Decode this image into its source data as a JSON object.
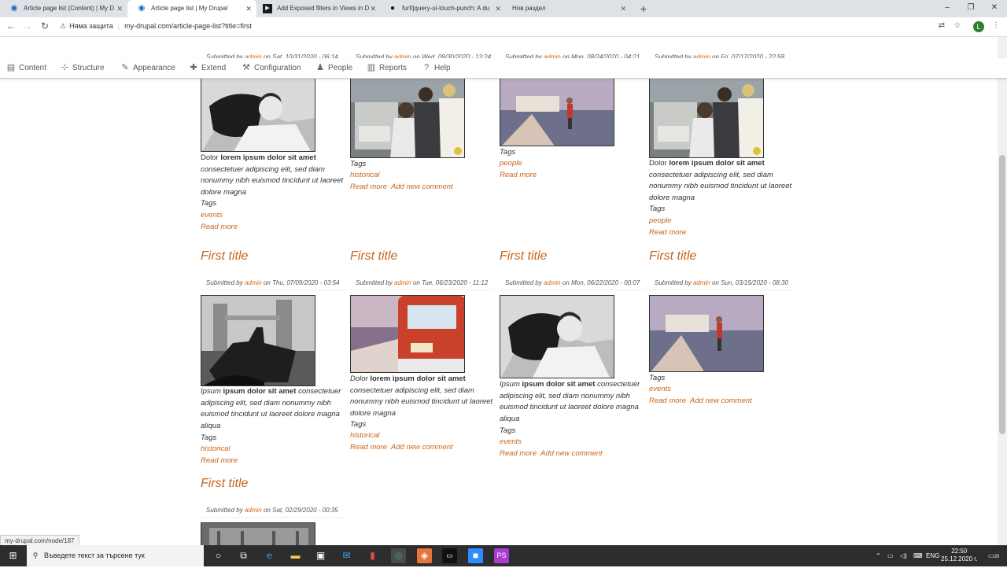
{
  "browser": {
    "tabs": [
      {
        "label": "Article page list (Content) | My D",
        "icon": "drupal-icon",
        "active": false
      },
      {
        "label": "Article page list | My Drupal",
        "icon": "drupal-icon",
        "active": true
      },
      {
        "label": "Add Exposed filters in Views in D",
        "icon": "video-icon",
        "active": false
      },
      {
        "label": "furf/jquery-ui-touch-punch: A du",
        "icon": "github-icon",
        "active": false
      },
      {
        "label": "Нов раздел",
        "icon": "",
        "active": false
      }
    ],
    "new_tab": "+",
    "window_controls": [
      "–",
      "❐",
      "✕"
    ],
    "security_label": "Няма защита",
    "url": "my-drupal.com/article-page-list?title=first",
    "profile_initial": "L"
  },
  "toolbar": {
    "items": [
      {
        "label": "Content",
        "icon": "content-icon"
      },
      {
        "label": "Structure",
        "icon": "structure-icon"
      },
      {
        "label": "Appearance",
        "icon": "appearance-icon"
      },
      {
        "label": "Extend",
        "icon": "extend-icon"
      },
      {
        "label": "Configuration",
        "icon": "configuration-icon"
      },
      {
        "label": "People",
        "icon": "people-icon"
      },
      {
        "label": "Reports",
        "icon": "reports-icon"
      },
      {
        "label": "Help",
        "icon": "help-icon"
      }
    ]
  },
  "content": {
    "submitted_by": "Submitted by",
    "on": "on",
    "author": "admin",
    "title": "First title",
    "tags_label": "Tags",
    "read_more": "Read more",
    "add_comment": "Add new comment",
    "top_row_dates": [
      "Sat, 10/31/2020 - 06:14",
      "Wed, 09/30/2020 - 13:24",
      "Mon, 08/24/2020 - 04:21",
      "Fri, 07/17/2020 - 22:58"
    ],
    "row1": {
      "c1": {
        "lead": "Dolor",
        "bold": "lorem ipsum dolor sit amet",
        "body": "consectetuer adipiscing elit, sed diam nonummy nibh euismod tincidunt ut laoreet dolore magna",
        "tag": "events"
      },
      "c2": {
        "tag": "historical"
      },
      "c3": {
        "tag": "people"
      },
      "c4": {
        "lead": "Dolor",
        "bold": "lorem ipsum dolor sit amet",
        "body": "consectetuer adipiscing elit, sed diam nonummy nibh euismod tincidunt ut laoreet dolore magna",
        "tag": "people"
      }
    },
    "row2": {
      "dates": [
        "Thu, 07/09/2020 - 03:54",
        "Tue, 06/23/2020 - 11:12",
        "Mon, 06/22/2020 - 00:07",
        "Sun, 03/15/2020 - 08:30"
      ],
      "c1": {
        "lead": "Ipsum",
        "bold": "ipsum dolor sit amet",
        "body": "consectetuer adipiscing elit, sed diam nonummy nibh euismod tincidunt ut laoreet dolore magna aliqua",
        "tag": "historical"
      },
      "c2": {
        "lead": "Dolor",
        "bold": "lorem ipsum dolor sit amet",
        "body": "consectetuer adipiscing elit, sed diam nonummy nibh euismod tincidunt ut laoreet dolore magna",
        "tag": "historical"
      },
      "c3": {
        "lead": "Ipsum",
        "bold": "ipsum dolor sit amet",
        "body": "consectetuer adipiscing elit, sed diam nonummy nibh euismod tincidunt ut laoreet dolore magna aliqua",
        "tag": "events"
      },
      "c4": {
        "tag": "events"
      }
    },
    "row3": {
      "date": "Sat, 02/29/2020 - 00:35"
    }
  },
  "status_url": "my-drupal.com/node/187",
  "taskbar": {
    "search_placeholder": "Въведете текст за търсене тук",
    "language": "ENG",
    "time": "22:50",
    "date": "25.12.2020 г.",
    "notifications": "20"
  },
  "colors": {
    "accent": "#c8641a",
    "toolbar_text": "#555555",
    "taskbar": "#2d2d30"
  }
}
